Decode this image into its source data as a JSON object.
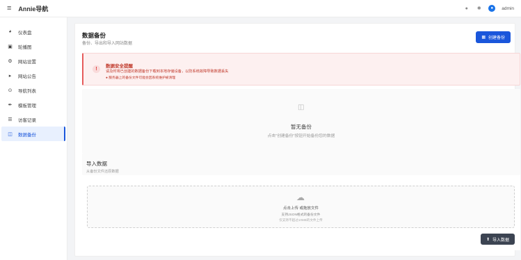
{
  "header": {
    "menu_icon": "menu-icon",
    "brand": "Annie导航",
    "user": "admin",
    "icons": [
      "message-icon",
      "settings-icon",
      "user-icon"
    ]
  },
  "sidebar": {
    "items": [
      {
        "label": "仪表盘",
        "icon": "dashboard-icon"
      },
      {
        "label": "轮播图",
        "icon": "image-icon"
      },
      {
        "label": "网站设置",
        "icon": "gear-icon"
      },
      {
        "label": "网站公告",
        "icon": "megaphone-icon"
      },
      {
        "label": "导航列表",
        "icon": "compass-icon"
      },
      {
        "label": "模板管理",
        "icon": "brush-icon"
      },
      {
        "label": "访客记录",
        "icon": "users-icon"
      },
      {
        "label": "数据备份",
        "icon": "database-icon",
        "active": true
      }
    ]
  },
  "main": {
    "title": "数据备份",
    "subtitle": "备份、导出和导入网站数据",
    "create_button": "创建备份",
    "warning": {
      "title": "数据安全提醒",
      "text": "请及时将已创建的数据备份下载到本地存储设备，以防系统故障导致数据丢失",
      "hint": "服务器上的备份文件可能会因系统维护被清理"
    },
    "empty": {
      "title": "暂无备份",
      "text": "点击\"创建备份\"按钮开始备份您的数据"
    },
    "import": {
      "title": "导入数据",
      "subtitle": "从备份文件还原数据",
      "dropzone_title": "点击上传 或拖放文件",
      "dropzone_sub": "支持JSON格式的备份文件",
      "dropzone_hint": "仅支持不超过10MB的文件上传",
      "button": "导入数据"
    }
  },
  "colors": {
    "accent": "#1a56db",
    "danger": "#c0392b",
    "dark_button": "#3c4452"
  }
}
